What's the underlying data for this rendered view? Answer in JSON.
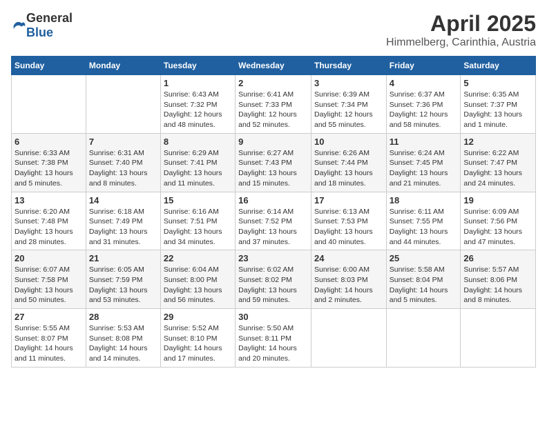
{
  "header": {
    "logo_general": "General",
    "logo_blue": "Blue",
    "title": "April 2025",
    "subtitle": "Himmelberg, Carinthia, Austria"
  },
  "calendar": {
    "days_of_week": [
      "Sunday",
      "Monday",
      "Tuesday",
      "Wednesday",
      "Thursday",
      "Friday",
      "Saturday"
    ],
    "weeks": [
      [
        {
          "day": "",
          "info": ""
        },
        {
          "day": "",
          "info": ""
        },
        {
          "day": "1",
          "info": "Sunrise: 6:43 AM\nSunset: 7:32 PM\nDaylight: 12 hours\nand 48 minutes."
        },
        {
          "day": "2",
          "info": "Sunrise: 6:41 AM\nSunset: 7:33 PM\nDaylight: 12 hours\nand 52 minutes."
        },
        {
          "day": "3",
          "info": "Sunrise: 6:39 AM\nSunset: 7:34 PM\nDaylight: 12 hours\nand 55 minutes."
        },
        {
          "day": "4",
          "info": "Sunrise: 6:37 AM\nSunset: 7:36 PM\nDaylight: 12 hours\nand 58 minutes."
        },
        {
          "day": "5",
          "info": "Sunrise: 6:35 AM\nSunset: 7:37 PM\nDaylight: 13 hours\nand 1 minute."
        }
      ],
      [
        {
          "day": "6",
          "info": "Sunrise: 6:33 AM\nSunset: 7:38 PM\nDaylight: 13 hours\nand 5 minutes."
        },
        {
          "day": "7",
          "info": "Sunrise: 6:31 AM\nSunset: 7:40 PM\nDaylight: 13 hours\nand 8 minutes."
        },
        {
          "day": "8",
          "info": "Sunrise: 6:29 AM\nSunset: 7:41 PM\nDaylight: 13 hours\nand 11 minutes."
        },
        {
          "day": "9",
          "info": "Sunrise: 6:27 AM\nSunset: 7:43 PM\nDaylight: 13 hours\nand 15 minutes."
        },
        {
          "day": "10",
          "info": "Sunrise: 6:26 AM\nSunset: 7:44 PM\nDaylight: 13 hours\nand 18 minutes."
        },
        {
          "day": "11",
          "info": "Sunrise: 6:24 AM\nSunset: 7:45 PM\nDaylight: 13 hours\nand 21 minutes."
        },
        {
          "day": "12",
          "info": "Sunrise: 6:22 AM\nSunset: 7:47 PM\nDaylight: 13 hours\nand 24 minutes."
        }
      ],
      [
        {
          "day": "13",
          "info": "Sunrise: 6:20 AM\nSunset: 7:48 PM\nDaylight: 13 hours\nand 28 minutes."
        },
        {
          "day": "14",
          "info": "Sunrise: 6:18 AM\nSunset: 7:49 PM\nDaylight: 13 hours\nand 31 minutes."
        },
        {
          "day": "15",
          "info": "Sunrise: 6:16 AM\nSunset: 7:51 PM\nDaylight: 13 hours\nand 34 minutes."
        },
        {
          "day": "16",
          "info": "Sunrise: 6:14 AM\nSunset: 7:52 PM\nDaylight: 13 hours\nand 37 minutes."
        },
        {
          "day": "17",
          "info": "Sunrise: 6:13 AM\nSunset: 7:53 PM\nDaylight: 13 hours\nand 40 minutes."
        },
        {
          "day": "18",
          "info": "Sunrise: 6:11 AM\nSunset: 7:55 PM\nDaylight: 13 hours\nand 44 minutes."
        },
        {
          "day": "19",
          "info": "Sunrise: 6:09 AM\nSunset: 7:56 PM\nDaylight: 13 hours\nand 47 minutes."
        }
      ],
      [
        {
          "day": "20",
          "info": "Sunrise: 6:07 AM\nSunset: 7:58 PM\nDaylight: 13 hours\nand 50 minutes."
        },
        {
          "day": "21",
          "info": "Sunrise: 6:05 AM\nSunset: 7:59 PM\nDaylight: 13 hours\nand 53 minutes."
        },
        {
          "day": "22",
          "info": "Sunrise: 6:04 AM\nSunset: 8:00 PM\nDaylight: 13 hours\nand 56 minutes."
        },
        {
          "day": "23",
          "info": "Sunrise: 6:02 AM\nSunset: 8:02 PM\nDaylight: 13 hours\nand 59 minutes."
        },
        {
          "day": "24",
          "info": "Sunrise: 6:00 AM\nSunset: 8:03 PM\nDaylight: 14 hours\nand 2 minutes."
        },
        {
          "day": "25",
          "info": "Sunrise: 5:58 AM\nSunset: 8:04 PM\nDaylight: 14 hours\nand 5 minutes."
        },
        {
          "day": "26",
          "info": "Sunrise: 5:57 AM\nSunset: 8:06 PM\nDaylight: 14 hours\nand 8 minutes."
        }
      ],
      [
        {
          "day": "27",
          "info": "Sunrise: 5:55 AM\nSunset: 8:07 PM\nDaylight: 14 hours\nand 11 minutes."
        },
        {
          "day": "28",
          "info": "Sunrise: 5:53 AM\nSunset: 8:08 PM\nDaylight: 14 hours\nand 14 minutes."
        },
        {
          "day": "29",
          "info": "Sunrise: 5:52 AM\nSunset: 8:10 PM\nDaylight: 14 hours\nand 17 minutes."
        },
        {
          "day": "30",
          "info": "Sunrise: 5:50 AM\nSunset: 8:11 PM\nDaylight: 14 hours\nand 20 minutes."
        },
        {
          "day": "",
          "info": ""
        },
        {
          "day": "",
          "info": ""
        },
        {
          "day": "",
          "info": ""
        }
      ]
    ]
  }
}
